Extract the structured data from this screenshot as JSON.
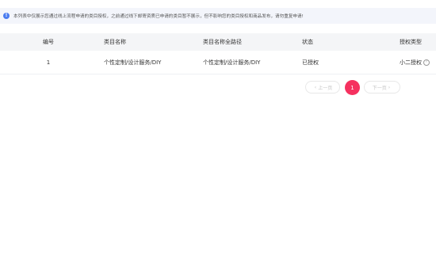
{
  "notice": {
    "text": "本列表中仅展示您通过线上流程申请的类目授权，之前通过线下邮寄资质已申请的类目暂不展示，但不影响您的类目授权和商品发布，请勿重复申请!"
  },
  "table": {
    "headers": [
      "编号",
      "类目名称",
      "类目名称全路径",
      "状态",
      "授权类型"
    ],
    "rows": [
      {
        "num": "1",
        "category": "个性定制/设计服务/DIY",
        "path": "个性定制/设计服务/DIY",
        "status": "已授权",
        "type": "小二授权"
      }
    ]
  },
  "pager": {
    "prev_label": "上一页",
    "current_page": "1",
    "next_label": "下一页"
  },
  "colors": {
    "accent": "#f5315f",
    "info_icon": "#4a7cf0",
    "notice_bg": "#f3f5fb",
    "header_bg": "#f4f5f7"
  },
  "icons": [
    "info-icon",
    "help-icon",
    "chevron-left-icon",
    "chevron-right-icon"
  ]
}
